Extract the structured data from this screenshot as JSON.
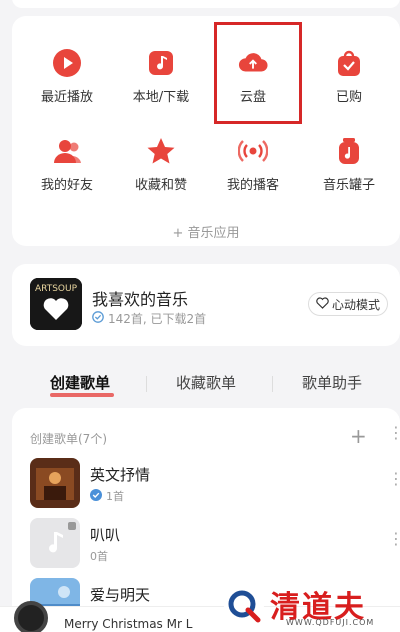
{
  "apps": {
    "row1": [
      {
        "label": "最近播放",
        "icon": "play-icon"
      },
      {
        "label": "本地/下载",
        "icon": "music-note-icon"
      },
      {
        "label": "云盘",
        "icon": "cloud-upload-icon"
      },
      {
        "label": "已购",
        "icon": "purchased-bag-icon"
      }
    ],
    "row2": [
      {
        "label": "我的好友",
        "icon": "friends-icon"
      },
      {
        "label": "收藏和赞",
        "icon": "star-icon"
      },
      {
        "label": "我的播客",
        "icon": "podcast-icon"
      },
      {
        "label": "音乐罐子",
        "icon": "music-jar-icon"
      }
    ],
    "more_label": "+ 音乐应用",
    "accent": "#e8453c"
  },
  "favorite": {
    "title": "我喜欢的音乐",
    "subtitle": "142首, 已下载2首",
    "cover_text": "ARTSOUP",
    "heart_mode_label": "心动模式"
  },
  "tabs": [
    {
      "label": "创建歌单",
      "active": true
    },
    {
      "label": "收藏歌单",
      "active": false
    },
    {
      "label": "歌单助手",
      "active": false
    }
  ],
  "playlists": {
    "header": "创建歌单(7个)",
    "items": [
      {
        "name": "英文抒情",
        "count": "1首",
        "verified": true
      },
      {
        "name": "叭叭",
        "count": "0首",
        "verified": false
      },
      {
        "name": "爱与明天",
        "count": "",
        "verified": false
      }
    ]
  },
  "mini_player": {
    "song": "Merry Christmas Mr L"
  },
  "watermark": {
    "text": "清道夫",
    "url": "WWW.QDFUJI.COM"
  }
}
